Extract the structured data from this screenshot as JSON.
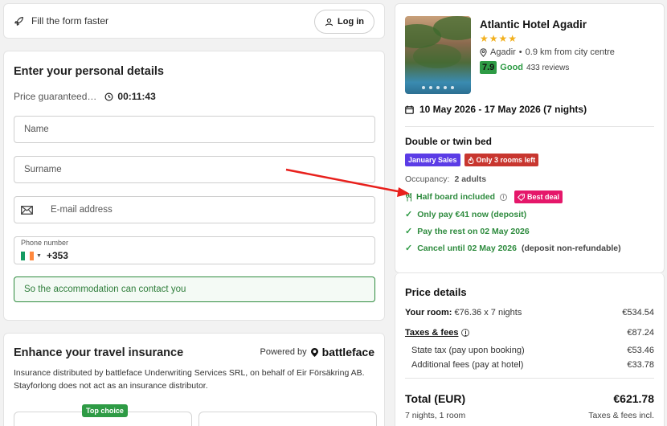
{
  "topbar": {
    "text": "Fill the form faster",
    "login_label": "Log in"
  },
  "personal": {
    "title": "Enter your personal details",
    "price_guaranteed": "Price guaranteed…",
    "timer": "00:11:43",
    "name_placeholder": "Name",
    "surname_placeholder": "Surname",
    "email_placeholder": "E-mail address",
    "phone_label": "Phone number",
    "phone_code": "+353",
    "contact_note": "So the accommodation can contact you"
  },
  "insurance": {
    "title": "Enhance your travel insurance",
    "powered_by": "Powered by",
    "brand": "battleface",
    "text": "Insurance distributed by battleface Underwriting Services SRL, on behalf of Eir Försäkring AB. Stayforlong does not act as an insurance distributor.",
    "top_choice": "Top choice"
  },
  "hotel": {
    "name": "Atlantic Hotel Agadir",
    "stars": "★★★★",
    "city": "Agadir",
    "distance": "0.9 km from city centre",
    "score": "7.9",
    "rating_word": "Good",
    "reviews": "433 reviews",
    "dates": "10 May 2026 - 17 May 2026 (7 nights)",
    "room_type": "Double or twin bed",
    "badge_sale": "January Sales",
    "badge_rooms": "Only 3 rooms left",
    "occupancy_label": "Occupancy:",
    "occupancy_value": "2 adults",
    "meal": "Half board included",
    "badge_deal": "Best deal",
    "check1": "Only pay €41 now (deposit)",
    "check2": "Pay the rest on 02 May 2026",
    "check3": "Cancel until 02 May 2026",
    "check3_note": "(deposit non-refundable)"
  },
  "price": {
    "title": "Price details",
    "room_label": "Your room:",
    "room_detail": "€76.36 x 7 nights",
    "room_value": "€534.54",
    "taxes_label": "Taxes & fees",
    "taxes_value": "€87.24",
    "state_label": "State tax (pay upon booking)",
    "state_value": "€53.46",
    "add_label": "Additional fees (pay at hotel)",
    "add_value": "€33.78",
    "total_label": "Total (EUR)",
    "total_value": "€621.78",
    "nights_rooms": "7 nights, 1 room",
    "taxes_incl": "Taxes & fees incl."
  },
  "colors": {
    "green": "#2e9b45",
    "sale_purple": "#5b3ce6",
    "rooms_red": "#c8362f",
    "deal_pink": "#e5176a",
    "arrow_red": "#e8201c",
    "star_gold": "#f2b01e"
  },
  "icons": [
    "rocket-icon",
    "user-icon",
    "clock-icon",
    "mail-icon",
    "ireland-flag-icon",
    "battleface-logo-icon",
    "location-pin-icon",
    "calendar-icon",
    "flame-icon",
    "cutlery-icon",
    "info-icon",
    "tag-icon",
    "check-icon"
  ]
}
